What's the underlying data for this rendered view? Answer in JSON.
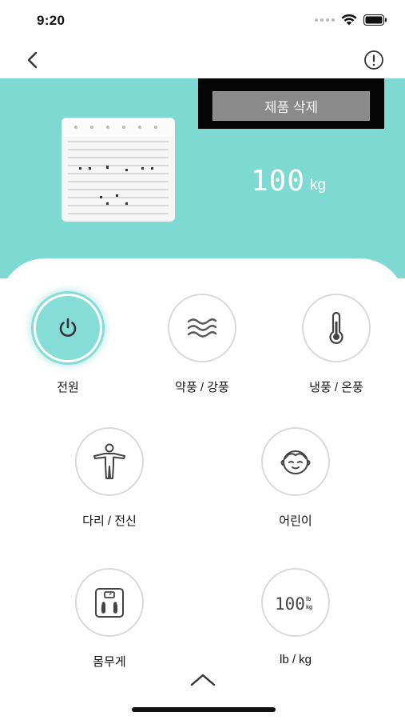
{
  "status_bar": {
    "time": "9:20",
    "icons": [
      "cellular-dots-icon",
      "wifi-icon",
      "battery-icon"
    ]
  },
  "nav": {
    "back_icon": "chevron-left-icon",
    "info_icon": "exclamation-circle-icon"
  },
  "device": {
    "image": "massage-device-image",
    "weight_value": "100",
    "weight_unit": "kg"
  },
  "delete_button_label": "제품 삭제",
  "controls": [
    {
      "id": "power",
      "label": "전원",
      "icon": "power-icon",
      "active": true
    },
    {
      "id": "wind",
      "label": "약풍 / 강풍",
      "icon": "wind-waves-icon",
      "active": false
    },
    {
      "id": "temp",
      "label": "냉풍 / 온풍",
      "icon": "thermometer-icon",
      "active": false
    },
    {
      "id": "body",
      "label": "다리 / 전신",
      "icon": "person-stretch-icon",
      "active": false
    },
    {
      "id": "child",
      "label": "어린이",
      "icon": "child-face-icon",
      "active": false
    },
    {
      "id": "weight",
      "label": "몸무게",
      "icon": "scale-feet-icon",
      "active": false
    },
    {
      "id": "unit",
      "label": "lb / kg",
      "icon": "lb-kg-display-icon",
      "active": false
    }
  ],
  "unit_icon_digits": "100",
  "colors": {
    "hero_teal": "#7fd9d3",
    "active_teal": "#86dcd6",
    "delete_panel": "#050505",
    "delete_button": "#8a8a8a"
  },
  "collapse_icon": "chevron-up-icon"
}
